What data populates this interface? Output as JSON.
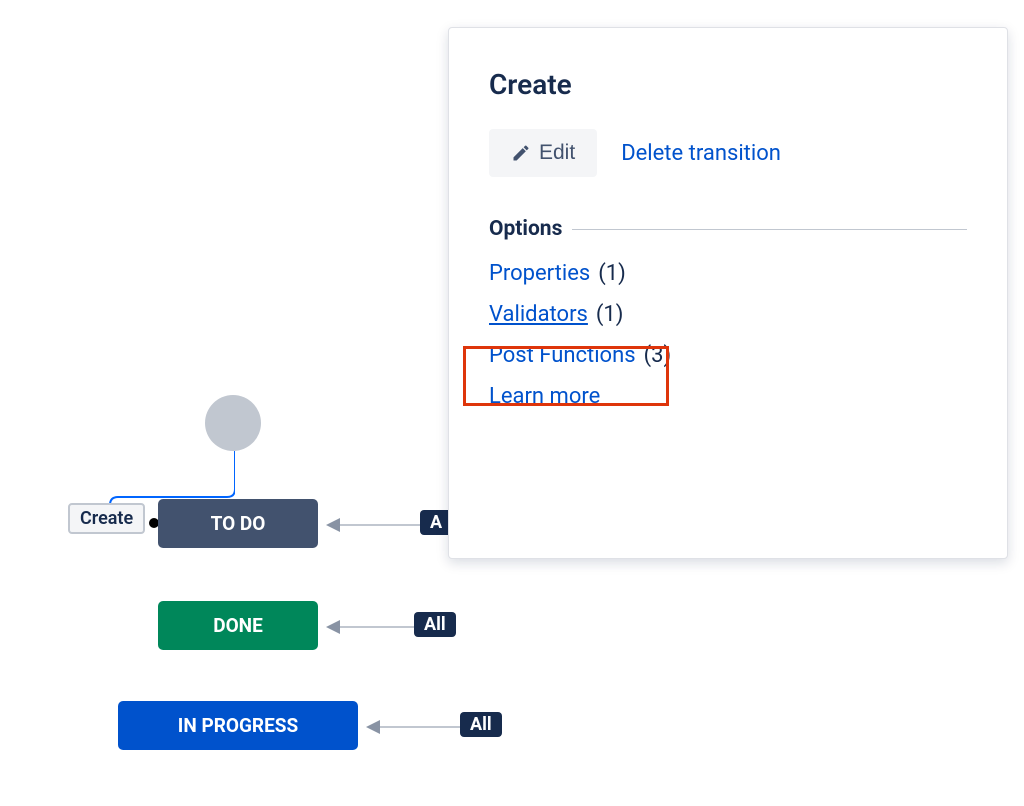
{
  "workflow": {
    "create_label": "Create",
    "statuses": {
      "todo": "TO DO",
      "done": "DONE",
      "in_progress": "IN PROGRESS"
    },
    "all_badges": {
      "todo": "A",
      "done": "All",
      "in_progress": "All"
    }
  },
  "panel": {
    "title": "Create",
    "edit_label": "Edit",
    "delete_label": "Delete transition",
    "options_title": "Options",
    "properties": {
      "label": "Properties",
      "count": "(1)"
    },
    "validators": {
      "label": "Validators",
      "count": "(1)"
    },
    "post_functions": {
      "label": "Post Functions",
      "count": "(3)"
    },
    "learn_more": "Learn more"
  }
}
